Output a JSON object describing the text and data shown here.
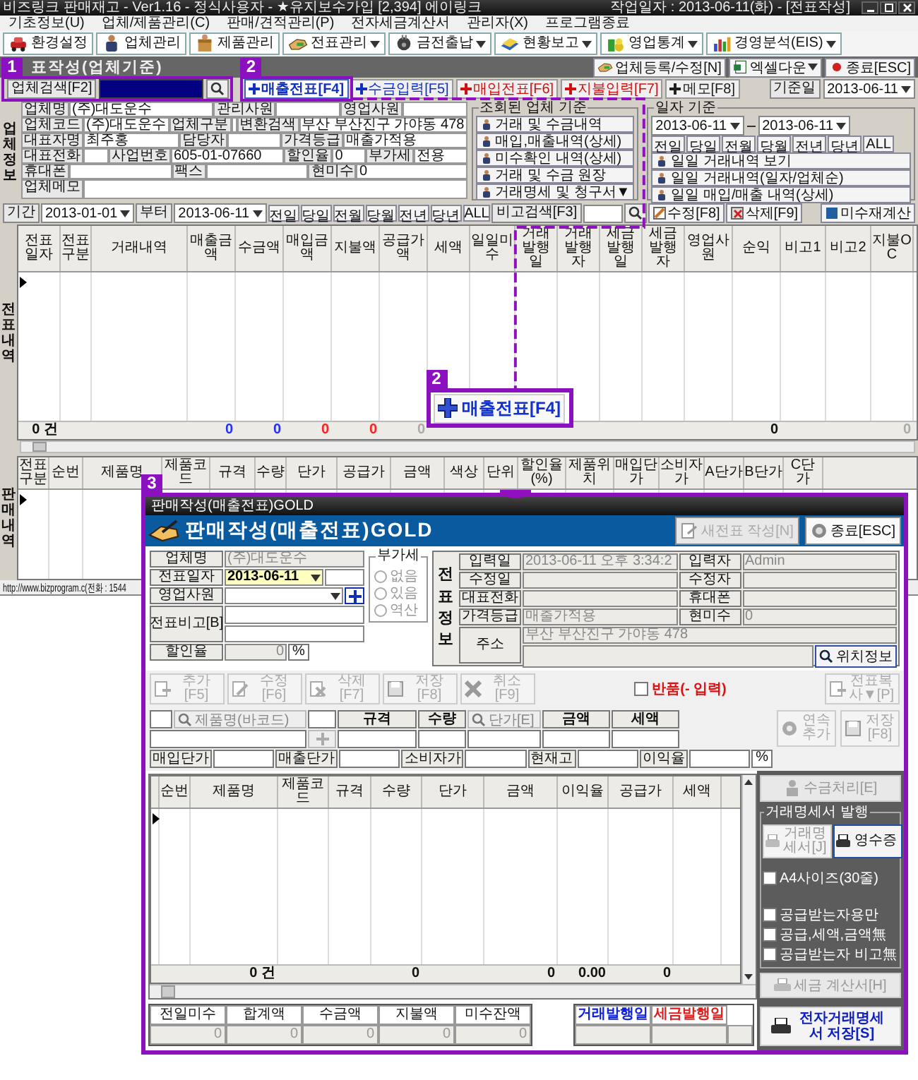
{
  "window": {
    "title": "비즈링크 판매재고 - Ver1.16 - 정식사용자 - ★유지보수가입 [2,394] 에이링크",
    "work_date": "작업일자 : 2013-06-11(화) - [전표작성]"
  },
  "menu": [
    "기초정보(U)",
    "업체/제품관리(C)",
    "판매/견적관리(P)",
    "전자세금계산서",
    "관리자(X)",
    "프로그램종료"
  ],
  "toolbar": [
    {
      "label": "환경설정",
      "dropdown": false
    },
    {
      "label": "업체관리",
      "dropdown": false
    },
    {
      "label": "제품관리",
      "dropdown": false
    },
    {
      "label": "전표관리",
      "dropdown": true
    },
    {
      "label": "금전출납",
      "dropdown": true
    },
    {
      "label": "현황보고",
      "dropdown": true
    },
    {
      "label": "영업통계",
      "dropdown": true
    },
    {
      "label": "경영분석(EIS)",
      "dropdown": true
    }
  ],
  "section_title": "표작성(업체기준)",
  "top_actions": [
    {
      "label": "업체등록/수정[N]",
      "dropdown": false
    },
    {
      "label": "엑셀다운",
      "dropdown": true
    },
    {
      "label": "종료[ESC]",
      "dropdown": false
    }
  ],
  "search": {
    "label": "업체검색[F2]"
  },
  "slip_tabs": [
    {
      "label": "매출전표[F4]",
      "selected": true,
      "color": "#1030c0"
    },
    {
      "label": "수금입력[F5]",
      "selected": false,
      "color": "#1030c0"
    },
    {
      "label": "매입전표[F6]",
      "selected": false,
      "color": "#d01010"
    },
    {
      "label": "지불입력[F7]",
      "selected": false,
      "color": "#d01010"
    },
    {
      "label": "메모[F8]",
      "selected": false,
      "color": "#202020"
    }
  ],
  "base_date": {
    "label": "기준일",
    "value": "2013-06-11"
  },
  "company": {
    "side_label": "업체정보",
    "rows": [
      [
        {
          "label": "업체명",
          "value": "(주)대도운수"
        },
        {
          "label": "관리사원"
        },
        {
          "label": "영업사원"
        }
      ],
      [
        {
          "label": "업체코드",
          "value": "(주)대도운수"
        },
        {
          "label": "업체구분"
        },
        {
          "label": "변환검색",
          "value": "부산 부산진구 가야동 478"
        }
      ],
      [
        {
          "label": "대표자명",
          "value": "최주홍"
        },
        {
          "label": "담당자"
        },
        {
          "label": "가격등급",
          "value": "매출가적용"
        }
      ],
      [
        {
          "label": "대표전화"
        },
        {
          "label": "사업번호",
          "value": "605-01-07660"
        },
        {
          "label": "할인율",
          "value": "0"
        },
        {
          "label": "부가세",
          "value": "전용"
        }
      ],
      [
        {
          "label": "휴대폰"
        },
        {
          "label": "팩스"
        },
        {
          "label": "현미수",
          "value": "0"
        }
      ],
      [
        {
          "label": "업체메모"
        }
      ]
    ]
  },
  "company_group": {
    "title": "조회된 업체 기준",
    "buttons": [
      "거래 및 수금내역",
      "매입,매출내역(상세)",
      "미수확인 내역(상세)",
      "거래 및 수금 원장",
      "거래명세 및 청구서▼"
    ]
  },
  "date_group": {
    "title": "일자 기준",
    "from": "2013-06-11",
    "to": "2013-06-11",
    "quick": [
      "전일",
      "당일",
      "전월",
      "당월",
      "전년",
      "당년",
      "ALL"
    ],
    "buttons": [
      "일일 거래내역 보기",
      "일일 거래내역(일자/업체순)",
      "일일 매입/매출 내역(상세)"
    ]
  },
  "filter": {
    "period_label": "기간",
    "from": "2013-01-01",
    "to_label": "부터",
    "to": "2013-06-11",
    "quick": [
      "전일",
      "당일",
      "전월",
      "당월",
      "전년",
      "당년",
      "ALL"
    ],
    "memo_search": "비고검색[F3]",
    "actions": [
      "수정[F8]",
      "삭제[F9]"
    ],
    "recalc": "미수재계산"
  },
  "slips_table": {
    "side_label": "전표내역",
    "columns": [
      {
        "label": "전표일자",
        "total": {
          "text": "0 건",
          "color": "#111111"
        }
      },
      {
        "label": "전표구분"
      },
      {
        "label": "거래내역"
      },
      {
        "label": "매출금액",
        "total": {
          "text": "0",
          "color": "#2030ff"
        }
      },
      {
        "label": "수금액",
        "total": {
          "text": "0",
          "color": "#2030ff"
        }
      },
      {
        "label": "매입금액",
        "total": {
          "text": "0",
          "color": "#ff2020"
        }
      },
      {
        "label": "지불액",
        "total": {
          "text": "0",
          "color": "#ff2020"
        }
      },
      {
        "label": "공급가액",
        "total": {
          "text": "0",
          "color": "#aaaaaa"
        }
      },
      {
        "label": "세액"
      },
      {
        "label": "일일미수"
      },
      {
        "label": "거래발행일"
      },
      {
        "label": "거래발행자"
      },
      {
        "label": "세금발행일"
      },
      {
        "label": "세금발행자"
      },
      {
        "label": "영업사원"
      },
      {
        "label": "순익",
        "total": {
          "text": "0",
          "color": "#111111"
        }
      },
      {
        "label": "비고1"
      },
      {
        "label": "비고2"
      },
      {
        "label": "지불OC",
        "total": {
          "text": "0",
          "color": "#aaaaaa"
        }
      }
    ]
  },
  "sales_table": {
    "side_label": "판매내역",
    "columns": [
      {
        "label": "전표구분"
      },
      {
        "label": "순번"
      },
      {
        "label": "제품명"
      },
      {
        "label": "제품코드"
      },
      {
        "label": "규격"
      },
      {
        "label": "수량"
      },
      {
        "label": "단가"
      },
      {
        "label": "공급가"
      },
      {
        "label": "금액"
      },
      {
        "label": "색상"
      },
      {
        "label": "단위"
      },
      {
        "label": "할인율(%)"
      },
      {
        "label": "제품위치"
      },
      {
        "label": "매입단가"
      },
      {
        "label": "소비자가"
      },
      {
        "label": "A단가"
      },
      {
        "label": "B단가"
      },
      {
        "label": "C단가"
      }
    ]
  },
  "status_bar": "http://www.bizprogram.c(전화 : 1544",
  "annotations": {
    "badges": [
      "1",
      "2",
      "2",
      "3"
    ],
    "callout": "매출전표[F4]"
  },
  "dialog": {
    "title": "판매작성(매출전표)GOLD",
    "heading": "판매작성(매출전표)GOLD",
    "header_buttons": [
      {
        "label": "새전표 작성[N]",
        "disabled": true
      },
      {
        "label": "종료[ESC]",
        "disabled": false
      }
    ],
    "company_name": {
      "label": "업체명",
      "value": "(주)대도운수"
    },
    "slip_date": {
      "label": "전표일자",
      "value": "2013-06-11"
    },
    "sales_rep": {
      "label": "영업사원"
    },
    "slip_memo": {
      "label": "전표비고[B]"
    },
    "discount": {
      "label": "할인율",
      "value": "0",
      "unit": "%"
    },
    "vat": {
      "title": "부가세",
      "options": [
        {
          "label": "없음",
          "selected": false
        },
        {
          "label": "있음",
          "selected": false
        },
        {
          "label": "역산",
          "selected": false
        }
      ]
    },
    "info": {
      "side_label": "전표정보",
      "rows": [
        [
          {
            "label": "입력일",
            "value": "2013-06-11 오후 3:34:2"
          },
          {
            "label": "입력자",
            "value": "Admin"
          }
        ],
        [
          {
            "label": "수정일"
          },
          {
            "label": "수정자"
          }
        ],
        [
          {
            "label": "대표전화"
          },
          {
            "label": "휴대폰"
          }
        ],
        [
          {
            "label": "가격등급",
            "value": "매출가적용"
          },
          {
            "label": "현미수",
            "value": "0"
          }
        ]
      ],
      "address": {
        "label": "주소",
        "value": "부산 부산진구 가야동 478"
      },
      "locate": "위치정보"
    },
    "actions": [
      {
        "label": "추가[F5]",
        "disabled": true
      },
      {
        "label": "수정[F6]",
        "disabled": true
      },
      {
        "label": "삭제[F7]",
        "disabled": true
      },
      {
        "label": "저장[F8]",
        "disabled": true
      },
      {
        "label": "취소[F9]",
        "disabled": true
      }
    ],
    "return_check": {
      "label": "반품(- 입력)",
      "checked": false
    },
    "copy_button": {
      "label": "전표복사▼[P]",
      "disabled": true
    },
    "entry": {
      "product_search": "제품명(바코드)",
      "price_search": "단가[E]",
      "columns": [
        "규격",
        "수량",
        "금액",
        "세액"
      ],
      "add_more": {
        "label": "연속추가",
        "disabled": true
      },
      "save": {
        "label": "저장[F8]",
        "disabled": true
      },
      "prices": [
        {
          "label": "매입단가"
        },
        {
          "label": "매출단가"
        },
        {
          "label": "소비자가"
        },
        {
          "label": "현재고"
        },
        {
          "label": "이익율",
          "unit": "%"
        }
      ]
    },
    "items_table": {
      "columns": [
        {
          "label": "순번"
        },
        {
          "label": "제품명",
          "total": "0 건"
        },
        {
          "label": "제품코드"
        },
        {
          "label": "규격"
        },
        {
          "label": "수량",
          "total": "0"
        },
        {
          "label": "단가"
        },
        {
          "label": "금액",
          "total": "0"
        },
        {
          "label": "이익율",
          "total": "0.00"
        },
        {
          "label": "공급가",
          "total": "0"
        },
        {
          "label": "세액"
        }
      ]
    },
    "payment_button": {
      "label": "수금처리[E]",
      "disabled": true
    },
    "print_group": {
      "title": "거래명세서 발행",
      "buttons": [
        {
          "label": "거래명세서[J]",
          "disabled": true
        },
        {
          "label": "영수증",
          "disabled": false
        }
      ],
      "options": [
        {
          "label": "A4사이즈(30줄)",
          "checked": false
        },
        {
          "label": "공급받는자용만",
          "checked": false
        },
        {
          "label": "공급,세액,금액無",
          "checked": false
        },
        {
          "label": "공급받는자 비고無",
          "checked": false
        }
      ]
    },
    "tax_invoice": {
      "label": "세금 계산서[H]",
      "disabled": true
    },
    "e_statement": {
      "label": "전자거래명세서 저장[S]",
      "disabled": false
    },
    "summary": [
      {
        "label": "전일미수",
        "value": "0"
      },
      {
        "label": "합계액",
        "value": "0"
      },
      {
        "label": "수금액",
        "value": "0"
      },
      {
        "label": "지불액",
        "value": "0"
      },
      {
        "label": "미수잔액",
        "value": "0"
      }
    ],
    "issue_dates": [
      {
        "label": "거래발행일",
        "color": "#1020e0"
      },
      {
        "label": "세금발행일",
        "color": "#e02020"
      }
    ]
  }
}
